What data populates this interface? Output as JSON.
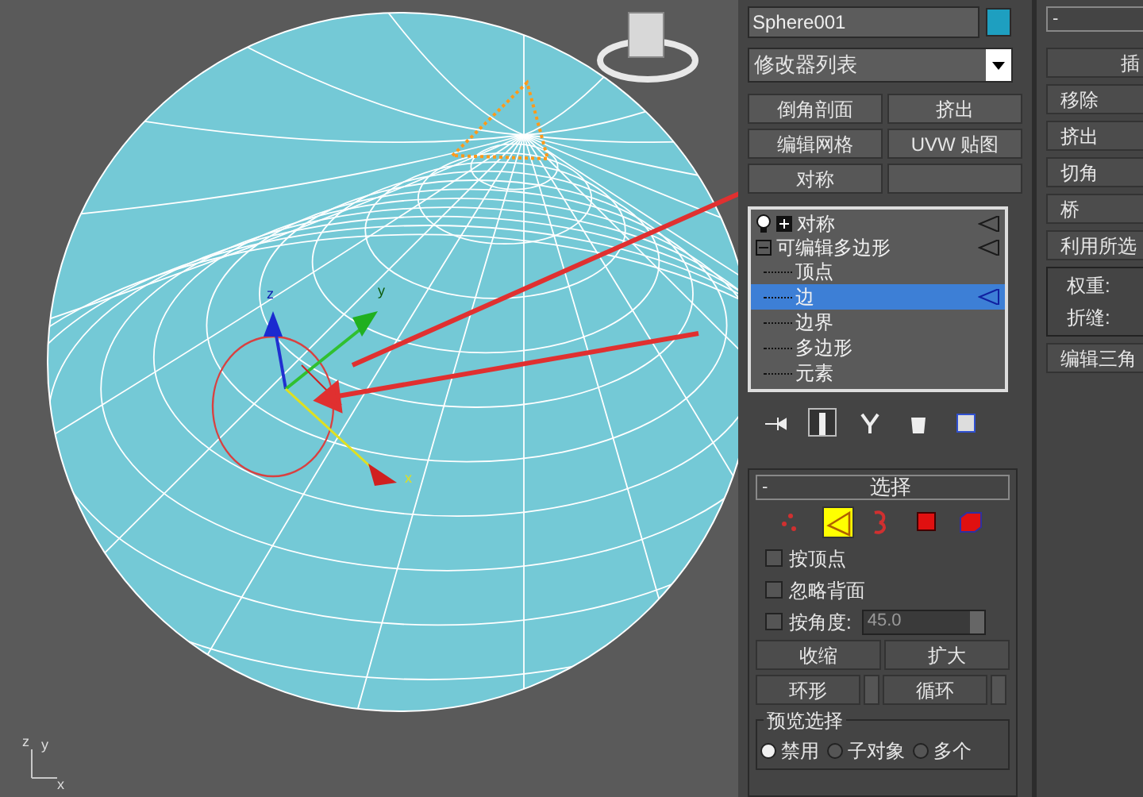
{
  "viewport": {
    "gizmo_labels": [
      "z",
      "y",
      "x"
    ],
    "axis_labels": [
      "z",
      "y",
      "x"
    ]
  },
  "object": {
    "name": "Sphere001",
    "color": "#1e9fc0"
  },
  "modifier_list": {
    "value": "修改器列表"
  },
  "modifier_buttons": [
    "倒角剖面",
    "挤出",
    "编辑网格",
    "UVW 贴图",
    "对称"
  ],
  "stack": [
    {
      "label": "对称",
      "on": true,
      "expanded": false,
      "selected": false
    },
    {
      "label": "可编辑多边形",
      "expanded": true,
      "selected": false,
      "children": [
        {
          "label": "顶点",
          "selected": false
        },
        {
          "label": "边",
          "selected": true
        },
        {
          "label": "边界",
          "selected": false
        },
        {
          "label": "多边形",
          "selected": false
        },
        {
          "label": "元素",
          "selected": false
        }
      ]
    }
  ],
  "selection": {
    "title": "选择",
    "collapse": "-",
    "levels": [
      {
        "kind": "vertex",
        "selected": false
      },
      {
        "kind": "edge",
        "selected": true
      },
      {
        "kind": "border",
        "selected": false
      },
      {
        "kind": "polygon",
        "selected": false
      },
      {
        "kind": "element",
        "selected": false
      }
    ],
    "checkboxes": [
      {
        "label": "按顶点",
        "checked": false
      },
      {
        "label": "忽略背面",
        "checked": false
      },
      {
        "label": "按角度:",
        "checked": false
      }
    ],
    "angle_value": "45.0",
    "buttons": [
      "收缩",
      "扩大"
    ],
    "spin_buttons": [
      "环形",
      "循环"
    ],
    "preview": {
      "title": "预览选择",
      "options": [
        {
          "label": "禁用",
          "selected": true
        },
        {
          "label": "子对象",
          "selected": false
        },
        {
          "label": "多个",
          "selected": false
        }
      ]
    }
  },
  "edit_edges": {
    "collapse": "-",
    "buttons": [
      "插",
      "移除",
      "挤出",
      "切角",
      "桥",
      "利用所选"
    ],
    "fields": [
      "权重:",
      "折缝:"
    ],
    "last_button": "编辑三角"
  }
}
